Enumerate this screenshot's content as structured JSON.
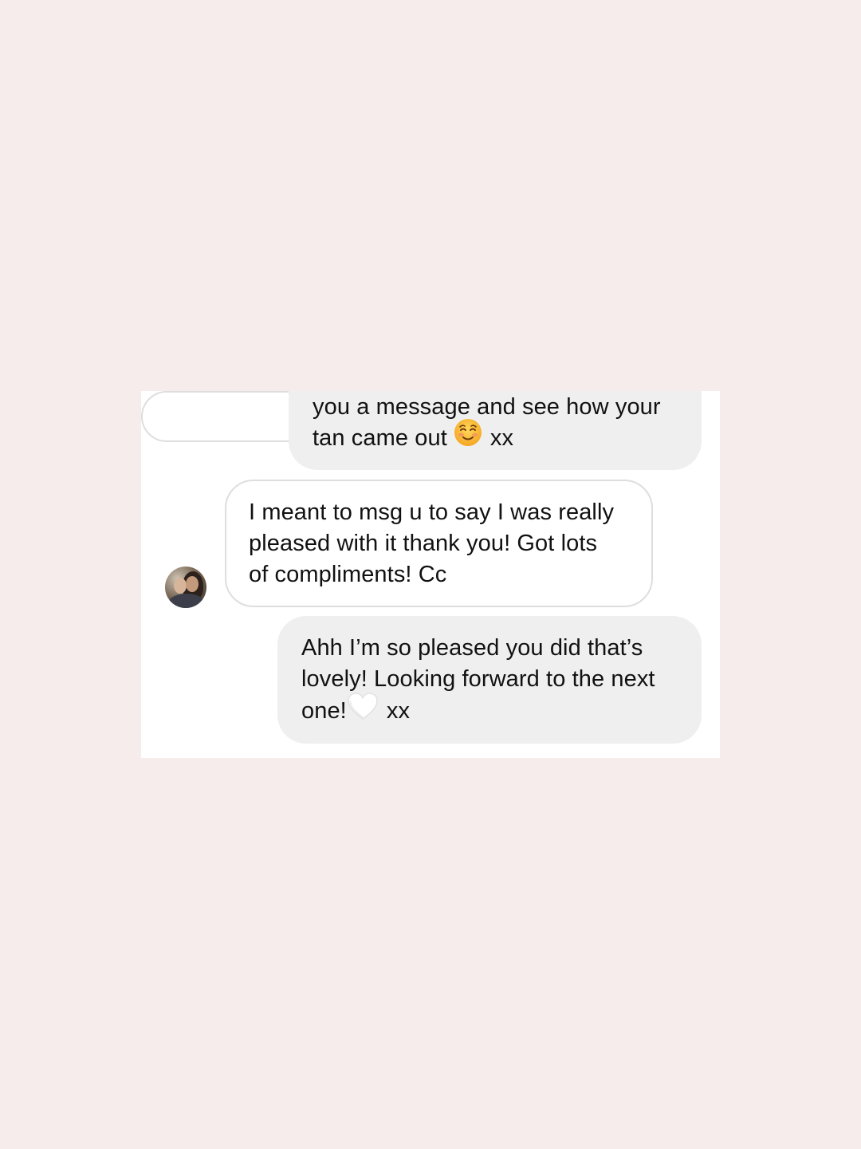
{
  "conversation": {
    "messages": [
      {
        "sender": "me",
        "lines": [
          "you a message and see how your",
          "tan came out"
        ],
        "suffix": "xx",
        "emoji": "smiling-face-icon"
      },
      {
        "sender": "them",
        "lines": [
          "I meant to msg u to say I was really",
          "pleased with it thank you! Got lots",
          "of compliments! Cc"
        ]
      },
      {
        "sender": "me",
        "lines": [
          "Ahh I’m so pleased you did that’s",
          "lovely! Looking forward to the next"
        ],
        "last_line_start": "one!",
        "suffix": "xx",
        "emoji": "white-heart-icon"
      }
    ]
  },
  "colors": {
    "page_background": "#f5eceb",
    "chat_background": "#ffffff",
    "outgoing_bubble": "#efefef",
    "incoming_border": "#dedede",
    "text": "#111111"
  }
}
